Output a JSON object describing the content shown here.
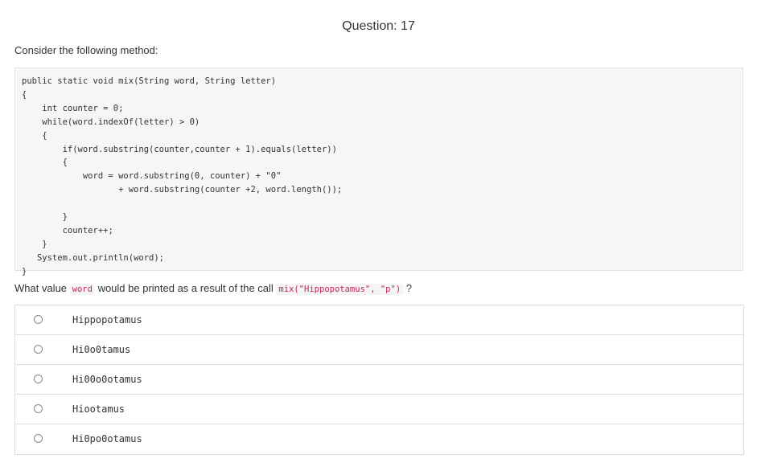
{
  "header": {
    "question_label": "Question: 17"
  },
  "question": {
    "intro": "Consider the following method:",
    "prompt_before": "What value ",
    "prompt_var": "word",
    "prompt_middle": " would be printed as a result of the call ",
    "prompt_call": "mix(\"Hippopotamus\", \"p\")",
    "prompt_after": " ?"
  },
  "code": {
    "line1": "public static void mix(String word, String letter)",
    "line2": "{",
    "line3": "    int counter = 0;",
    "line4": "    while(word.indexOf(letter) > 0)",
    "line5": "    {",
    "line6": "        if(word.substring(counter,counter + 1).equals(letter))",
    "line7": "        {",
    "line8": "            word = word.substring(0, counter) + \"0\"",
    "line9": "                   + word.substring(counter +2, word.length());",
    "line10": "",
    "line11": "        }",
    "line12": "        counter++;",
    "line13": "    }",
    "line14": "   System.out.println(word);",
    "line15": "}"
  },
  "choices": [
    {
      "label": "Hippopotamus"
    },
    {
      "label": "Hi0o0tamus"
    },
    {
      "label": "Hi00o0otamus"
    },
    {
      "label": "Hiootamus"
    },
    {
      "label": "Hi0po0otamus"
    }
  ]
}
